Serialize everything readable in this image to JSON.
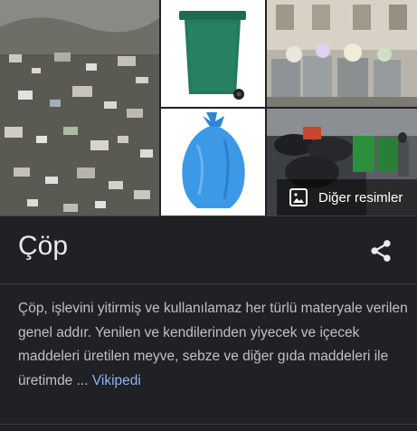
{
  "knowledge_panel": {
    "title": "Çöp",
    "more_images_label": "Diğer resimler",
    "description": "Çöp, işlevini yitirmiş ve kullanılamaz her türlü materyale verilen genel addır. Yenilen ve kendilerinden yiyecek ve içecek maddeleri üretilen meyve, sebze ve diğer gıda maddeleri ile üretimde ...",
    "source_link": "Vikipedi",
    "images": [
      {
        "subject": "landfill-waste-pile"
      },
      {
        "subject": "green-wheelie-bin"
      },
      {
        "subject": "street-garbage-bins"
      },
      {
        "subject": "blue-trash-bag"
      },
      {
        "subject": "city-garbage-street"
      }
    ]
  },
  "colors": {
    "background": "#202124",
    "title": "#e8eaed",
    "text": "#bdc1c6",
    "link": "#8ab4f8",
    "divider": "#3c4043"
  }
}
